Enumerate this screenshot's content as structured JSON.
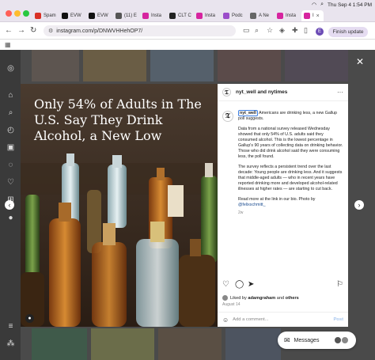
{
  "browser": {
    "tabs": [
      {
        "label": "Spam",
        "color": "#d93025",
        "active": false
      },
      {
        "label": "EVW",
        "color": "#111111",
        "active": false
      },
      {
        "label": "EVW",
        "color": "#111111",
        "active": false
      },
      {
        "label": "(11) E",
        "color": "#555555",
        "active": false
      },
      {
        "label": "Insta",
        "color": "#d6249f",
        "active": false
      },
      {
        "label": "CLT C",
        "color": "#222222",
        "active": false
      },
      {
        "label": "Insta",
        "color": "#d6249f",
        "active": false
      },
      {
        "label": "Podc",
        "color": "#9b4dca",
        "active": false
      },
      {
        "label": "A Ne",
        "color": "#666666",
        "active": false
      },
      {
        "label": "Insta",
        "color": "#d6249f",
        "active": false
      },
      {
        "label": "I",
        "color": "#d6249f",
        "active": true
      }
    ],
    "clock": "Thu Sep 4  1:54 PM",
    "url": "instagram.com/p/DNWVHHehOP7/",
    "avatar_letter": "E",
    "finish_update": "Finish update"
  },
  "post": {
    "headline": "Only 54% of Adults in The U.S. Say They Drink Alcohol, a New Low",
    "header_names": "nyt_well and nytimes",
    "caption_user": "nyt_well",
    "caption_p1": " Americans are drinking less, a new Gallup poll suggests.",
    "caption_p2": "Data from a national survey released Wednesday showed that only 54% of U.S. adults said they consumed alcohol. This is the lowest percentage in Gallup's 90 years of collecting data on drinking behavior. Those who did drink alcohol said they were consuming less, the poll found.",
    "caption_p3": "The survey reflects a persistent trend over the last decade: Young people are drinking less. And it suggests that middle-aged adults — who in recent years have reported drinking more and developed alcohol-related illnesses at higher rates — are starting to cut back.",
    "caption_p4": "Read more at the link in our bio. Photo by ",
    "caption_photo_credit": "@felixschmitt_",
    "caption_time": "2w",
    "liked_prefix": "Liked by ",
    "liked_user": "adamgraham",
    "liked_suffix": " and ",
    "liked_others": "others",
    "date": "August 14",
    "comment_placeholder": "Add a comment...",
    "post_label": "Post"
  },
  "messages": {
    "label": "Messages"
  },
  "icons": {
    "back": "back-arrow-icon",
    "forward": "forward-arrow-icon",
    "reload": "reload-icon",
    "close": "close-icon",
    "like": "heart-icon",
    "comment": "comment-icon",
    "share": "share-icon",
    "save": "bookmark-icon"
  }
}
